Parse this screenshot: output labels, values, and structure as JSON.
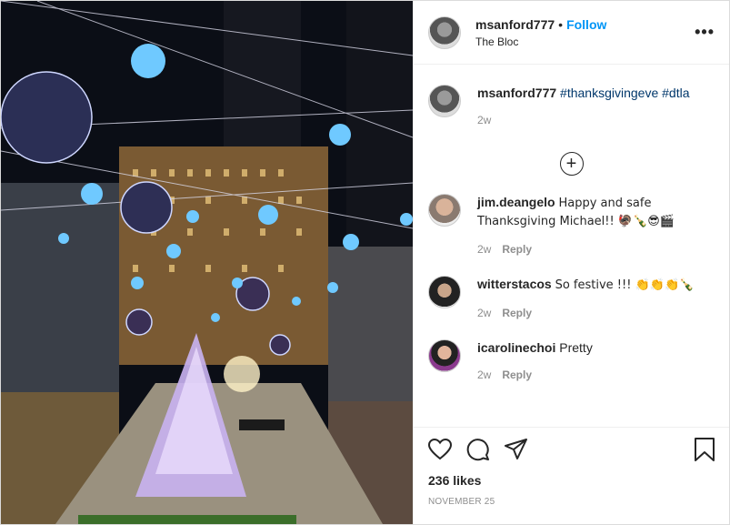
{
  "post": {
    "username": "msanford777",
    "follow_label": "Follow",
    "separator": "•",
    "location": "The Bloc",
    "more_label": "•••",
    "caption": {
      "username": "msanford777",
      "hashtags": [
        "#thanksgivingeve",
        "#dtla"
      ],
      "time": "2w"
    },
    "load_more_label": "+",
    "comments": [
      {
        "username": "jim.deangelo",
        "text": "Happy and safe Thanksgiving Michael!! 🦃🍾😎🎬",
        "time": "2w",
        "reply": "Reply"
      },
      {
        "username": "witterstacos",
        "text": "So festive !!! 👏👏👏🍾",
        "time": "2w",
        "reply": "Reply"
      },
      {
        "username": "icarolinechoi",
        "text": "Pretty",
        "time": "2w",
        "reply": "Reply"
      }
    ],
    "likes": "236 likes",
    "date": "NOVEMBER 25"
  },
  "colors": {
    "accent": "#0095f6",
    "hashtag": "#00376b",
    "muted": "#8e8e8e"
  },
  "icons": [
    "more-icon",
    "add-comment-icon",
    "like-icon",
    "comment-icon",
    "share-icon",
    "save-icon"
  ]
}
